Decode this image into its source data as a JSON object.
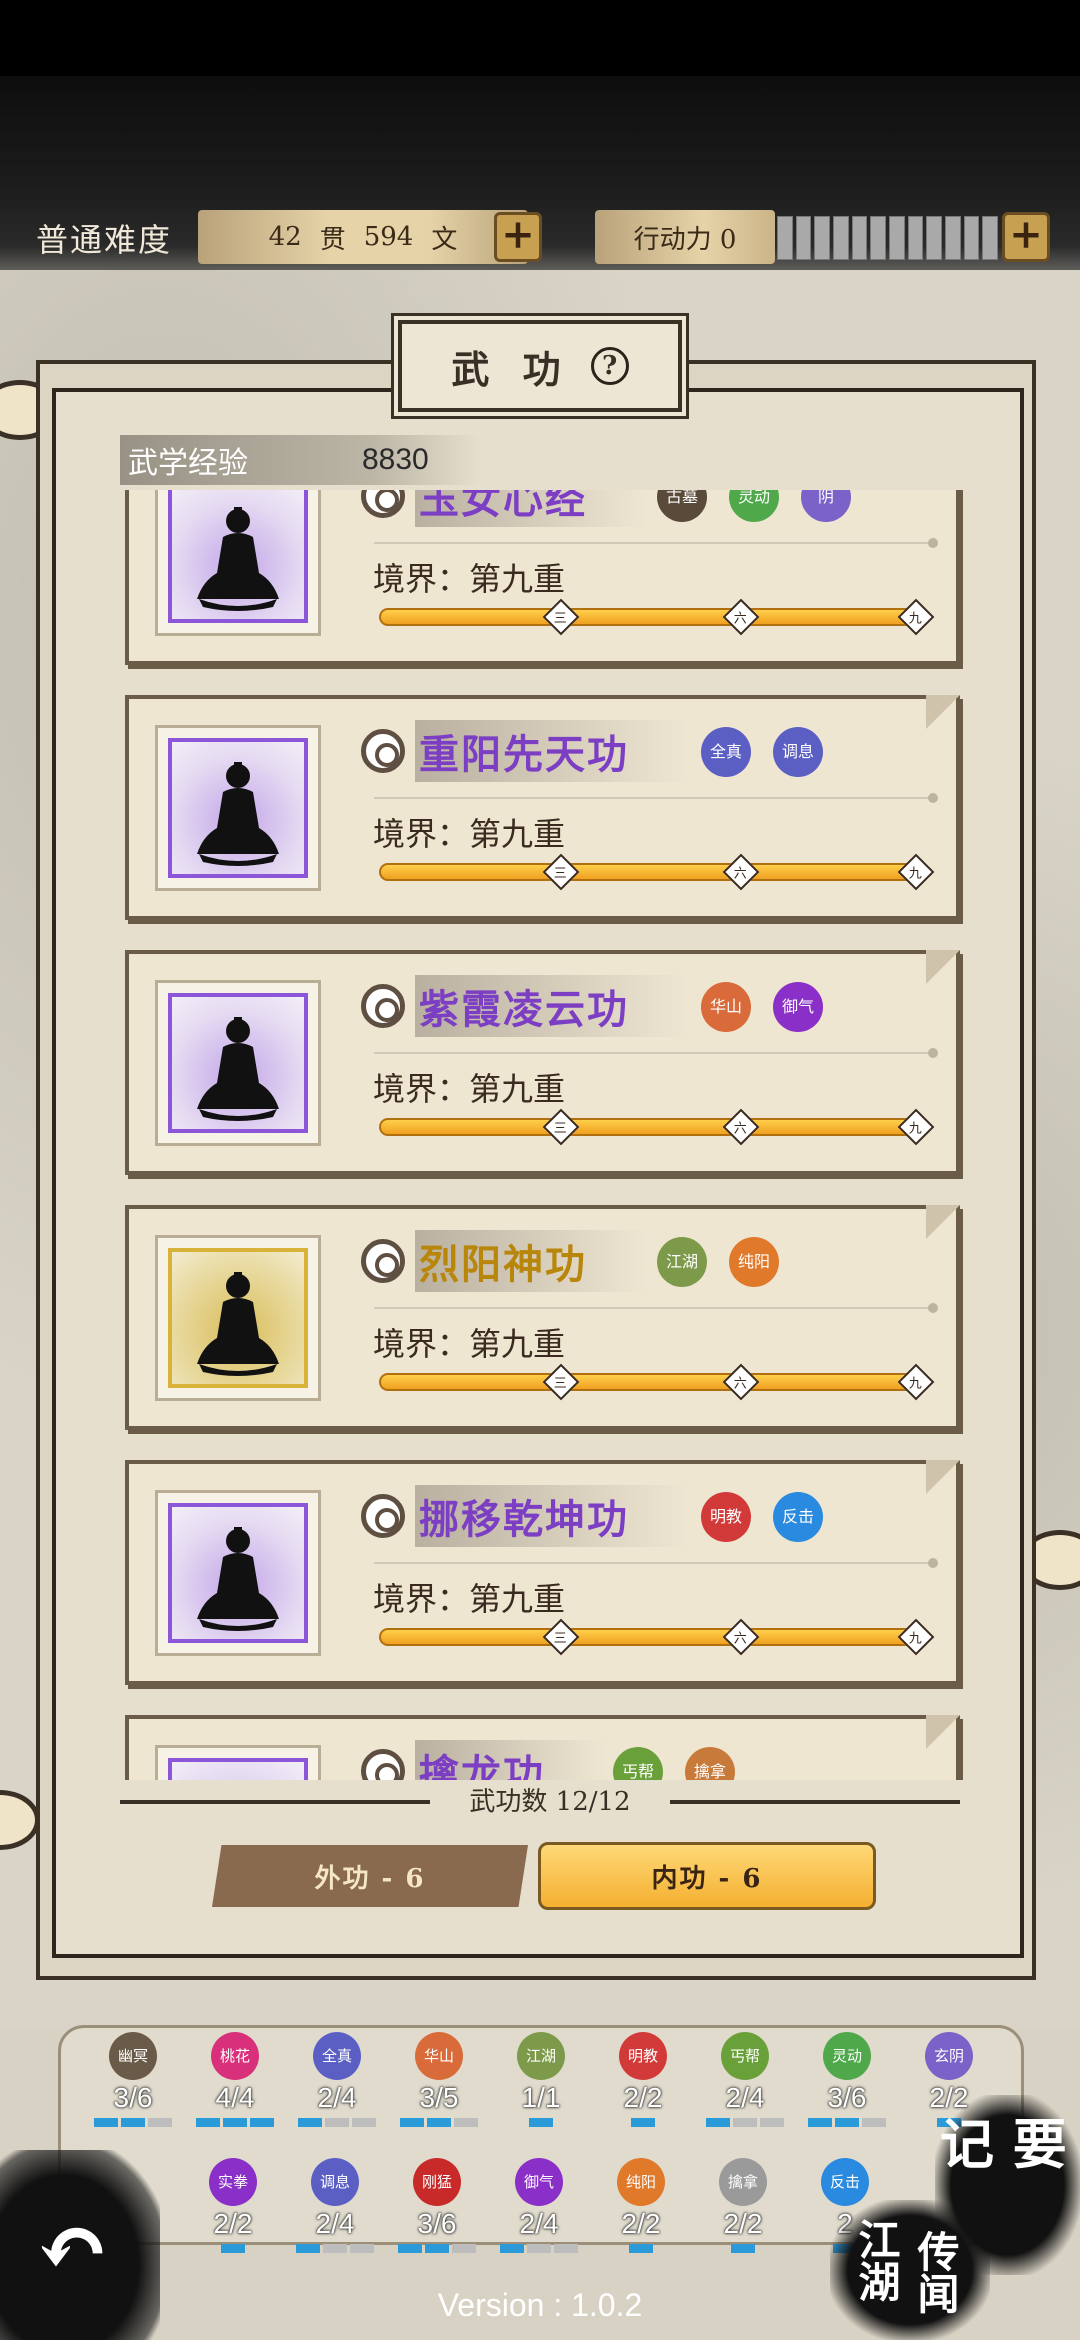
{
  "header": {
    "difficulty": "普通难度",
    "money_guan": "42",
    "guan_unit": "贯",
    "money_wen": "594",
    "wen_unit": "文",
    "action_label": "行动力 0",
    "action_bar_segments": 12,
    "action_bar_filled": 0
  },
  "panel": {
    "title": "武 功",
    "help_icon": "?",
    "exp_label": "武学经验",
    "exp_value": "8830"
  },
  "skills": [
    {
      "name": "玉女心经",
      "realm": "境界：第九重",
      "progress": 1.0,
      "tier": "purple",
      "badges": [
        {
          "text": "古墓",
          "color": "#5a4a3a"
        },
        {
          "text": "灵动",
          "color": "#4fa84a"
        },
        {
          "text": "阴",
          "color": "#7a62c8"
        }
      ]
    },
    {
      "name": "重阳先天功",
      "realm": "境界：第九重",
      "progress": 1.0,
      "tier": "purple",
      "badges": [
        {
          "text": "全真",
          "color": "#5b5fc4"
        },
        {
          "text": "调息",
          "color": "#5b5fc4"
        }
      ]
    },
    {
      "name": "紫霞凌云功",
      "realm": "境界：第九重",
      "progress": 1.0,
      "tier": "purple",
      "badges": [
        {
          "text": "华山",
          "color": "#d96a3a"
        },
        {
          "text": "御气",
          "color": "#8a2fc8"
        }
      ]
    },
    {
      "name": "烈阳神功",
      "realm": "境界：第九重",
      "progress": 1.0,
      "tier": "gold",
      "badges": [
        {
          "text": "江湖",
          "color": "#7c9a4a"
        },
        {
          "text": "纯阳",
          "color": "#e0792a"
        }
      ]
    },
    {
      "name": "挪移乾坤功",
      "realm": "境界：第九重",
      "progress": 1.0,
      "tier": "purple",
      "badges": [
        {
          "text": "明教",
          "color": "#d23a3a"
        },
        {
          "text": "反击",
          "color": "#2a8ae0"
        }
      ]
    },
    {
      "name": "擒龙功",
      "realm": "",
      "progress": 1.0,
      "tier": "purple",
      "badges": [
        {
          "text": "丐帮",
          "color": "#6aa03a"
        },
        {
          "text": "擒拿",
          "color": "#c87a3a"
        }
      ]
    }
  ],
  "markers": [
    "三",
    "六",
    "九"
  ],
  "count_text": "武功数 12/12",
  "tabs": {
    "outer": "外功 - 6",
    "inner": "内功 - 6"
  },
  "sects_row1": [
    {
      "name": "幽冥",
      "count": "3/6",
      "color": "#6a5a48",
      "pips": [
        1,
        1,
        0
      ]
    },
    {
      "name": "桃花",
      "count": "4/4",
      "color": "#d8307a",
      "pips": [
        1,
        1,
        1
      ]
    },
    {
      "name": "全真",
      "count": "2/4",
      "color": "#5b5fc4",
      "pips": [
        1,
        0,
        0
      ]
    },
    {
      "name": "华山",
      "count": "3/5",
      "color": "#d96a3a",
      "pips": [
        1,
        1,
        0
      ]
    },
    {
      "name": "江湖",
      "count": "1/1",
      "color": "#7c9a4a",
      "pips": [
        1
      ]
    },
    {
      "name": "明教",
      "count": "2/2",
      "color": "#d23a3a",
      "pips": [
        1
      ]
    },
    {
      "name": "丐帮",
      "count": "2/4",
      "color": "#6aa03a",
      "pips": [
        1,
        0,
        0
      ]
    },
    {
      "name": "灵动",
      "count": "3/6",
      "color": "#4fa84a",
      "pips": [
        1,
        1,
        0
      ]
    },
    {
      "name": "玄阴",
      "count": "2/2",
      "color": "#7a62c8",
      "pips": [
        1
      ]
    }
  ],
  "sects_row2": [
    {
      "name": "",
      "count": "",
      "color": "#8a4ab8",
      "pips": []
    },
    {
      "name": "实拳",
      "count": "2/2",
      "color": "#8a2fc8",
      "pips": [
        1
      ]
    },
    {
      "name": "调息",
      "count": "2/4",
      "color": "#5b5fc4",
      "pips": [
        1,
        0,
        0
      ]
    },
    {
      "name": "刚猛",
      "count": "3/6",
      "color": "#c82a2a",
      "pips": [
        1,
        1,
        0
      ]
    },
    {
      "name": "御气",
      "count": "2/4",
      "color": "#8a2fc8",
      "pips": [
        1,
        0,
        0
      ]
    },
    {
      "name": "纯阳",
      "count": "2/2",
      "color": "#e0792a",
      "pips": [
        1
      ]
    },
    {
      "name": "擒拿",
      "count": "2/2",
      "color": "#9a9a9a",
      "pips": [
        1
      ]
    },
    {
      "name": "反击",
      "count": "2",
      "color": "#2a8ae0",
      "pips": [
        1
      ]
    }
  ],
  "bottom": {
    "jiyao": "记 要",
    "jianghu": "江湖",
    "chuanwen": "传闻",
    "version": "Version : 1.0.2",
    "back_icon": "back-arrow-icon"
  }
}
